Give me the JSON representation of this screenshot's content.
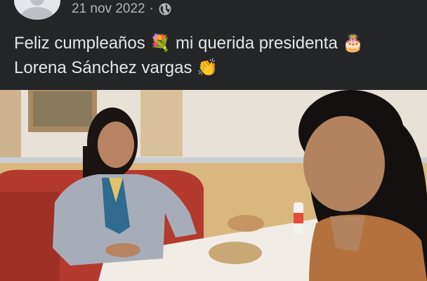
{
  "post": {
    "date": "21 nov 2022",
    "separator": "·",
    "privacy_icon": "globe-icon",
    "caption_line1_a": "Feliz cumpleaños",
    "caption_emoji_1": "💐",
    "caption_line1_b": "mi querida presidenta",
    "caption_emoji_2": "🎂",
    "caption_line2": "Lorena Sánchez vargas",
    "caption_emoji_3": "👏"
  },
  "photo": {
    "description_icon": "photo"
  },
  "colors": {
    "background": "#242526",
    "text": "#e4e6eb",
    "muted": "#b0b3b8"
  }
}
